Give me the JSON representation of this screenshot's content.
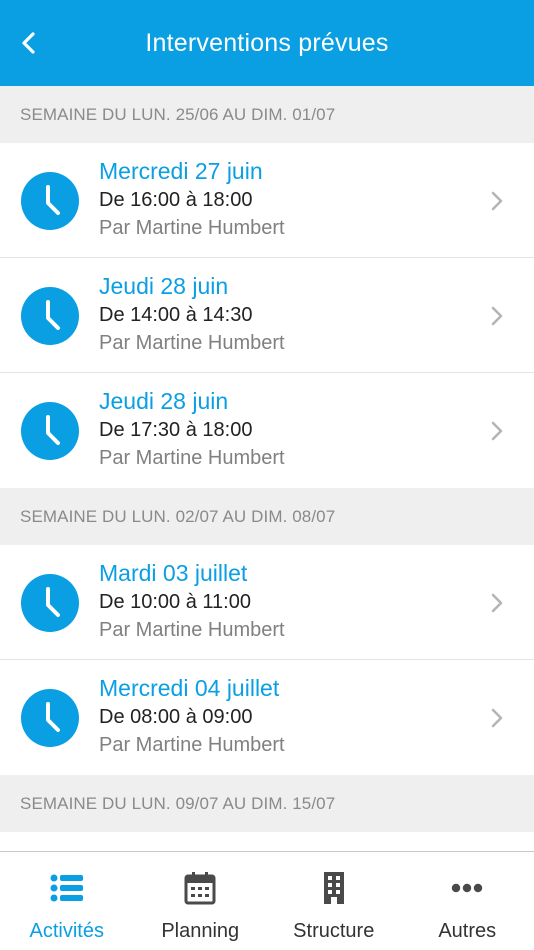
{
  "header": {
    "title": "Interventions prévues",
    "back_icon": "chevron-left-icon"
  },
  "sections": [
    {
      "title": "SEMAINE DU LUN. 25/06 AU DIM. 01/07",
      "items": [
        {
          "date": "Mercredi 27 juin",
          "time": "De 16:00 à 18:00",
          "by": "Par Martine Humbert"
        },
        {
          "date": "Jeudi 28 juin",
          "time": "De 14:00 à 14:30",
          "by": "Par Martine Humbert"
        },
        {
          "date": "Jeudi 28 juin",
          "time": "De 17:30 à 18:00",
          "by": "Par Martine Humbert"
        }
      ]
    },
    {
      "title": "SEMAINE DU LUN. 02/07 AU DIM. 08/07",
      "items": [
        {
          "date": "Mardi 03 juillet",
          "time": "De 10:00 à 11:00",
          "by": "Par Martine Humbert"
        },
        {
          "date": "Mercredi 04 juillet",
          "time": "De 08:00 à 09:00",
          "by": "Par Martine Humbert"
        }
      ]
    },
    {
      "title": "SEMAINE DU LUN. 09/07 AU DIM. 15/07",
      "items": []
    }
  ],
  "tabs": [
    {
      "label": "Activités",
      "icon": "list-icon",
      "active": true
    },
    {
      "label": "Planning",
      "icon": "calendar-icon",
      "active": false
    },
    {
      "label": "Structure",
      "icon": "building-icon",
      "active": false
    },
    {
      "label": "Autres",
      "icon": "more-dots-icon",
      "active": false
    }
  ],
  "colors": {
    "accent": "#0a9fe3",
    "section_bg": "#efefef",
    "section_text": "#8a8a8a",
    "secondary_text": "#808080"
  }
}
